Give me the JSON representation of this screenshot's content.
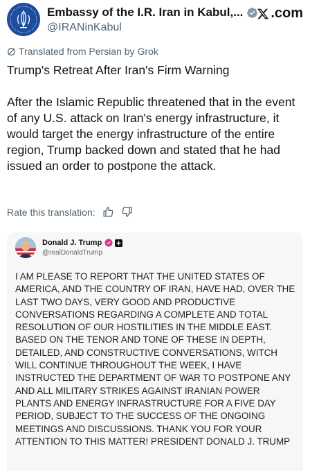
{
  "post": {
    "author_name": "Embassy of the I.R. Iran in Kabul,...",
    "author_handle": "@IRANinKabul",
    "platform": ".com",
    "translation_note": "Translated from Persian by Grok",
    "text_title": "Trump's Retreat After Iran's Firm Warning",
    "text_body": "After the Islamic Republic threatened that in the event of any U.S. attack on Iran's energy infrastructure, it would target the energy infrastructure of the entire region, Trump backed down and stated that he had issued an order to postpone the attack.",
    "rate_label": "Rate this translation:"
  },
  "embedded": {
    "author_name": "Donald J. Trump",
    "author_handle": "@realDonaldTrump",
    "text": "I AM PLEASE TO REPORT THAT THE UNITED STATES OF AMERICA, AND THE COUNTRY OF IRAN, HAVE HAD, OVER THE LAST TWO DAYS, VERY GOOD AND PRODUCTIVE CONVERSATIONS REGARDING A COMPLETE AND TOTAL RESOLUTION OF OUR HOSTILITIES IN THE MIDDLE EAST. BASED ON THE TENOR AND TONE OF THESE IN DEPTH, DETAILED, AND CONSTRUCTIVE CONVERSATIONS, WITCH WILL CONTINUE THROUGHOUT THE WEEK, I HAVE INSTRUCTED THE DEPARTMENT OF WAR TO POSTPONE ANY AND ALL MILITARY STRIKES AGAINST IRANIAN POWER PLANTS AND ENERGY INFRASTRUCTURE FOR A FIVE DAY PERIOD, SUBJECT TO THE SUCCESS OF THE ONGOING MEETINGS AND DISCUSSIONS. THANK YOU FOR YOUR ATTENTION TO THIS MATTER! PRESIDENT DONALD J. TRUMP"
  },
  "icons": {
    "verified": "verified-badge-icon",
    "x_logo": "x-logo-icon",
    "grok": "grok-icon",
    "thumbs_up": "thumbs-up-icon",
    "thumbs_down": "thumbs-down-icon"
  },
  "colors": {
    "text": "#0f1419",
    "muted": "#536471",
    "verified_gray": "#829aab",
    "truth_verified": "#d4357f",
    "embed_bg": "#f7f7f7"
  }
}
